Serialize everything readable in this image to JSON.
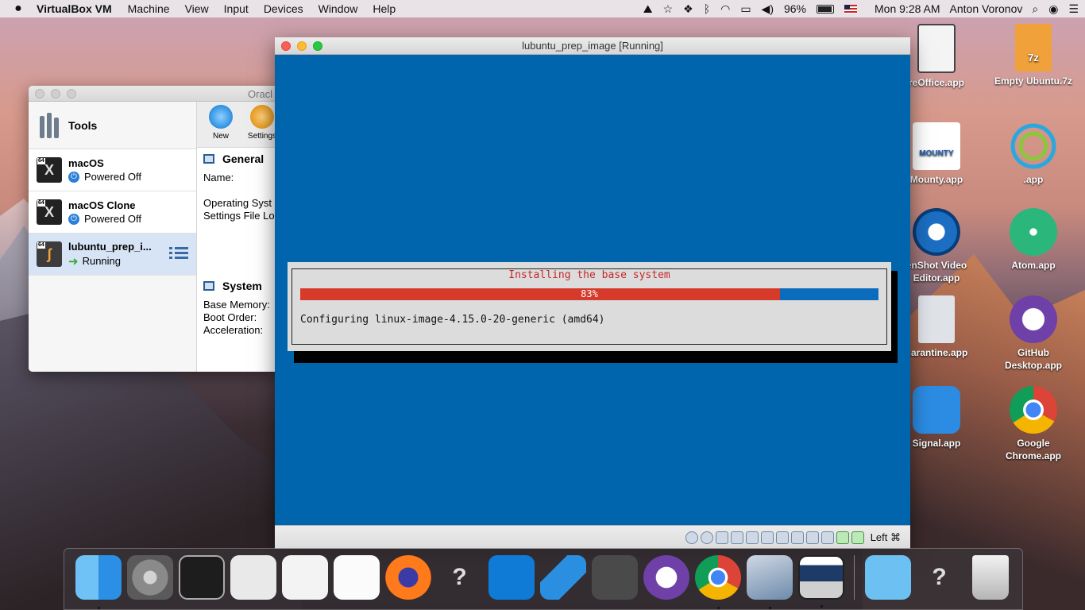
{
  "menubar": {
    "apple": "",
    "app_name": "VirtualBox VM",
    "items": [
      "Machine",
      "View",
      "Input",
      "Devices",
      "Window",
      "Help"
    ],
    "battery": "96%",
    "clock": "Mon 9:28 AM",
    "user": "Anton Voronov"
  },
  "desktop_icons": [
    {
      "label": "reOffice.app",
      "icon": "libreoffice-file-icon"
    },
    {
      "label": "Empty Ubuntu.7z",
      "icon": "7z-archive-icon",
      "badge": "7z"
    },
    {
      "label": "Mounty.app",
      "icon": "mounty-icon",
      "badge": "MOUNTY"
    },
    {
      "label": ".app",
      "icon": "rings-app-icon"
    },
    {
      "label": "enShot Video Editor.app",
      "icon": "openshot-icon"
    },
    {
      "label": "Atom.app",
      "icon": "atom-icon"
    },
    {
      "label": "uarantine.app",
      "icon": "quarantine-icon"
    },
    {
      "label": "GitHub Desktop.app",
      "icon": "github-desktop-icon"
    },
    {
      "label": "Signal.app",
      "icon": "signal-icon"
    },
    {
      "label": "Google Chrome.app",
      "icon": "chrome-icon"
    }
  ],
  "manager": {
    "title": "Oracl",
    "tools_label": "Tools",
    "toolbar": {
      "new": "New",
      "settings": "Settings"
    },
    "vms": [
      {
        "name": "macOS",
        "state": "Powered Off",
        "badge": "64",
        "os_glyph": "X"
      },
      {
        "name": "macOS Clone",
        "state": "Powered Off",
        "badge": "64",
        "os_glyph": "X"
      },
      {
        "name": "lubuntu_prep_i...",
        "state": "Running",
        "badge": "64",
        "os_glyph": "ʃ"
      }
    ],
    "general": {
      "heading": "General",
      "rows": [
        "Name:",
        "",
        "Operating Syst",
        "Settings File Lo"
      ]
    },
    "system": {
      "heading": "System",
      "rows": [
        "Base Memory:",
        "Boot Order:",
        "Acceleration:"
      ]
    }
  },
  "vm_window": {
    "title": "lubuntu_prep_image [Running]",
    "host_key": "Left ⌘",
    "installer": {
      "title": "Installing the base system",
      "progress_percent": 83,
      "progress_label": "83%",
      "message": "Configuring linux-image-4.15.0-20-generic (amd64)"
    }
  },
  "dock": [
    {
      "name": "finder",
      "running": true
    },
    {
      "name": "system-preferences",
      "running": false
    },
    {
      "name": "terminal",
      "running": false
    },
    {
      "name": "script-editor",
      "running": false
    },
    {
      "name": "textedit-1",
      "running": false
    },
    {
      "name": "textedit-2",
      "running": false
    },
    {
      "name": "firefox",
      "running": false
    },
    {
      "name": "unknown-app-1",
      "running": false
    },
    {
      "name": "vnc-viewer",
      "running": false
    },
    {
      "name": "vscode",
      "running": false
    },
    {
      "name": "sublime-text",
      "running": false
    },
    {
      "name": "github-desktop",
      "running": false
    },
    {
      "name": "chrome",
      "running": true
    },
    {
      "name": "virtualbox",
      "running": true
    },
    {
      "name": "virtualbox-vm",
      "running": true
    },
    {
      "name": "downloads-folder",
      "running": false
    },
    {
      "name": "unknown-app-2",
      "running": false
    },
    {
      "name": "trash",
      "running": false
    }
  ],
  "colors": {
    "vm_screen": "#0065ad",
    "progress_fill": "#d53a2b",
    "progress_empty": "#0b6cbd",
    "dialog_title": "#c6282a",
    "selection": "#d6e4f6"
  }
}
